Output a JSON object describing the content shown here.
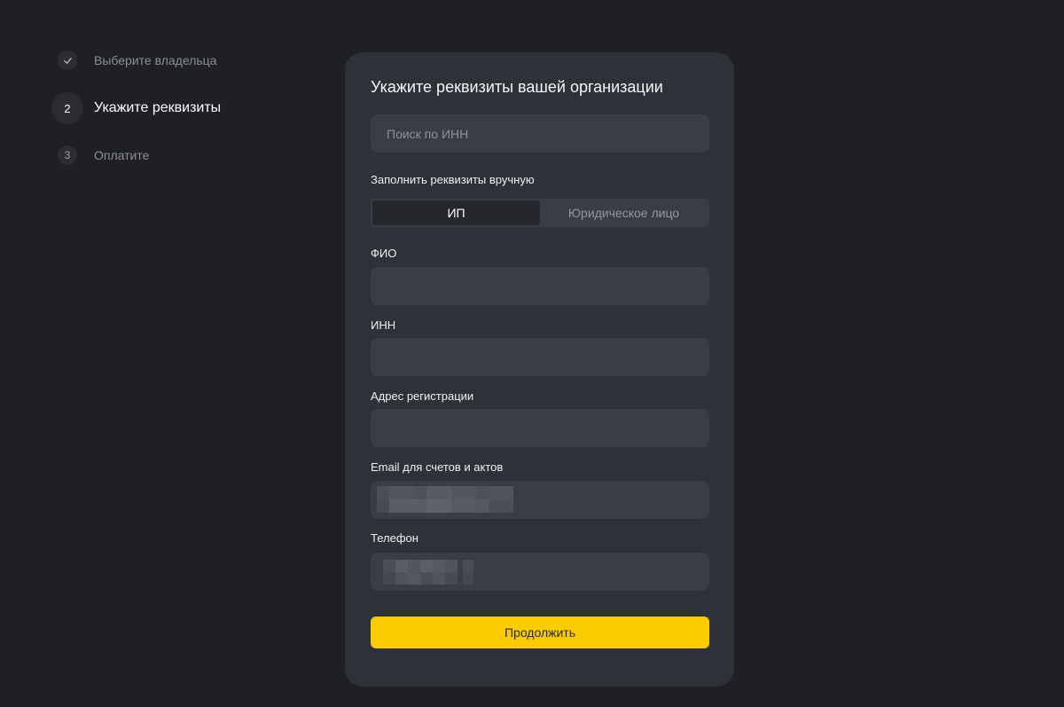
{
  "steps": [
    {
      "number": "",
      "label": "Выберите владельца",
      "state": "done",
      "icon": "check-icon"
    },
    {
      "number": "2",
      "label": "Укажите реквизиты",
      "state": "active"
    },
    {
      "number": "3",
      "label": "Оплатите",
      "state": "upcoming"
    }
  ],
  "form": {
    "title": "Укажите реквизиты вашей организации",
    "search_placeholder": "Поиск по ИНН",
    "manual_label": "Заполнить реквизиты вручную",
    "entity_types": [
      {
        "label": "ИП",
        "selected": true
      },
      {
        "label": "Юридическое лицо",
        "selected": false
      }
    ],
    "fields": {
      "fio_label": "ФИО",
      "inn_label": "ИНН",
      "address_label": "Адрес регистрации",
      "email_label": "Email для счетов и актов",
      "phone_label": "Телефон"
    },
    "continue_label": "Продолжить"
  },
  "colors": {
    "background": "#1f2023",
    "card": "#2e3137",
    "input": "#3a3d44",
    "accent": "#fccc03"
  }
}
